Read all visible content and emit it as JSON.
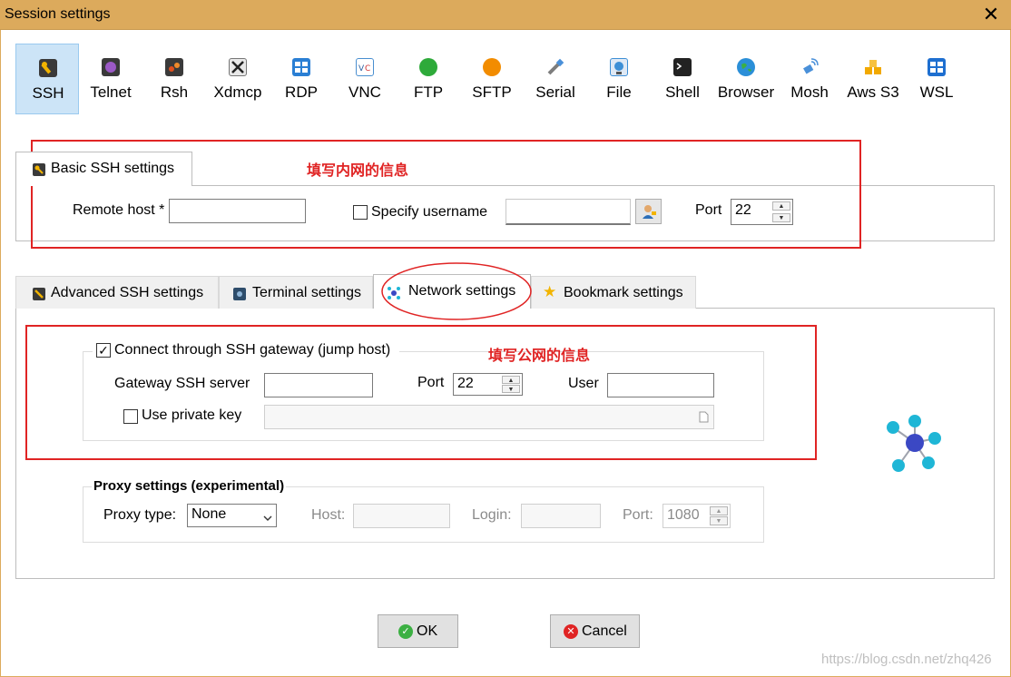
{
  "window": {
    "title": "Session settings",
    "close_glyph": "✕"
  },
  "protocols": [
    {
      "label": "SSH",
      "icon": "ssh-key-icon",
      "color": "#f2b400",
      "active": true
    },
    {
      "label": "Telnet",
      "icon": "telnet-icon",
      "color": "#7b3fa1"
    },
    {
      "label": "Rsh",
      "icon": "rsh-icon",
      "color": "#e0501e"
    },
    {
      "label": "Xdmcp",
      "icon": "xdmcp-icon",
      "color": "#3a3a3a"
    },
    {
      "label": "RDP",
      "icon": "rdp-icon",
      "color": "#2a7fd4"
    },
    {
      "label": "VNC",
      "icon": "vnc-icon",
      "color": "#4a8fd0"
    },
    {
      "label": "FTP",
      "icon": "ftp-icon",
      "color": "#2eaa3a"
    },
    {
      "label": "SFTP",
      "icon": "sftp-icon",
      "color": "#f28c00"
    },
    {
      "label": "Serial",
      "icon": "serial-icon",
      "color": "#7d7d7d"
    },
    {
      "label": "File",
      "icon": "file-icon",
      "color": "#3d8fd6"
    },
    {
      "label": "Shell",
      "icon": "shell-icon",
      "color": "#222222"
    },
    {
      "label": "Browser",
      "icon": "browser-icon",
      "color": "#2b8fd8"
    },
    {
      "label": "Mosh",
      "icon": "mosh-icon",
      "color": "#4a90d9"
    },
    {
      "label": "Aws S3",
      "icon": "aws-s3-icon",
      "color": "#f2a900"
    },
    {
      "label": "WSL",
      "icon": "wsl-icon",
      "color": "#1e6fd0"
    }
  ],
  "basic": {
    "tab_label": "Basic SSH settings",
    "annotation": "填写内网的信息",
    "remote_host_label": "Remote host *",
    "remote_host_value": "",
    "specify_username_label": "Specify username",
    "specify_username_checked": false,
    "username_value": "",
    "port_label": "Port",
    "port_value": "22"
  },
  "tabs": [
    {
      "label": "Advanced SSH settings",
      "icon": "wrench-key-icon"
    },
    {
      "label": "Terminal settings",
      "icon": "terminal-icon"
    },
    {
      "label": "Network settings",
      "icon": "network-icon",
      "selected": true
    },
    {
      "label": "Bookmark settings",
      "icon": "star-icon"
    }
  ],
  "network": {
    "annotation": "填写公网的信息",
    "gateway_checkbox_label": "Connect through SSH gateway (jump host)",
    "gateway_checked": true,
    "gateway_server_label": "Gateway SSH server",
    "gateway_server_value": "",
    "port_label": "Port",
    "port_value": "22",
    "user_label": "User",
    "user_value": "",
    "private_key_label": "Use private key",
    "private_key_checked": false
  },
  "proxy": {
    "group_label": "Proxy settings (experimental)",
    "type_label": "Proxy type:",
    "type_value": "None",
    "host_label": "Host:",
    "login_label": "Login:",
    "port_label": "Port:",
    "port_value": "1080"
  },
  "buttons": {
    "ok": "OK",
    "cancel": "Cancel"
  },
  "watermark": "https://blog.csdn.net/zhq426",
  "colors": {
    "titlebar": "#dcaa5c",
    "annotation": "#e02424",
    "selected_bg": "#cce4f7",
    "network_icon": "#1fb6d6",
    "network_hub": "#3b48c4"
  }
}
